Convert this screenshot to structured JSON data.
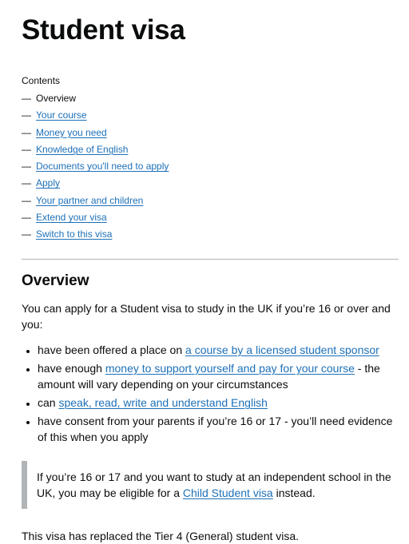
{
  "page": {
    "title": "Student visa"
  },
  "contents": {
    "title": "Contents",
    "dash": "—",
    "items": [
      {
        "label": "Overview",
        "current": true
      },
      {
        "label": "Your course"
      },
      {
        "label": "Money you need"
      },
      {
        "label": "Knowledge of English"
      },
      {
        "label": "Documents you'll need to apply"
      },
      {
        "label": "Apply"
      },
      {
        "label": "Your partner and children"
      },
      {
        "label": "Extend your visa"
      },
      {
        "label": "Switch to this visa"
      }
    ]
  },
  "overview": {
    "heading": "Overview",
    "intro": "You can apply for a Student visa to study in the UK if you’re 16 or over and you:",
    "bullets": [
      {
        "before": "have been offered a place on ",
        "link": "a course by a licensed student sponsor",
        "after": ""
      },
      {
        "before": "have enough ",
        "link": "money to support yourself and pay for your course",
        "after": " - the amount will vary depending on your circumstances"
      },
      {
        "before": "can ",
        "link": "speak, read, write and understand English",
        "after": ""
      },
      {
        "before": "have consent from your parents if you’re 16 or 17 - you’ll need evidence of this when you apply",
        "link": "",
        "after": ""
      }
    ],
    "inset": {
      "before": "If you’re 16 or 17 and you want to study at an independent school in the UK, you may be eligible for a ",
      "link": "Child Student visa",
      "after": " instead."
    },
    "note": "This visa has replaced the Tier 4 (General) student visa."
  },
  "colors": {
    "link": "#1d70b8",
    "text": "#0b0c0c",
    "border": "#b1b4b6"
  }
}
